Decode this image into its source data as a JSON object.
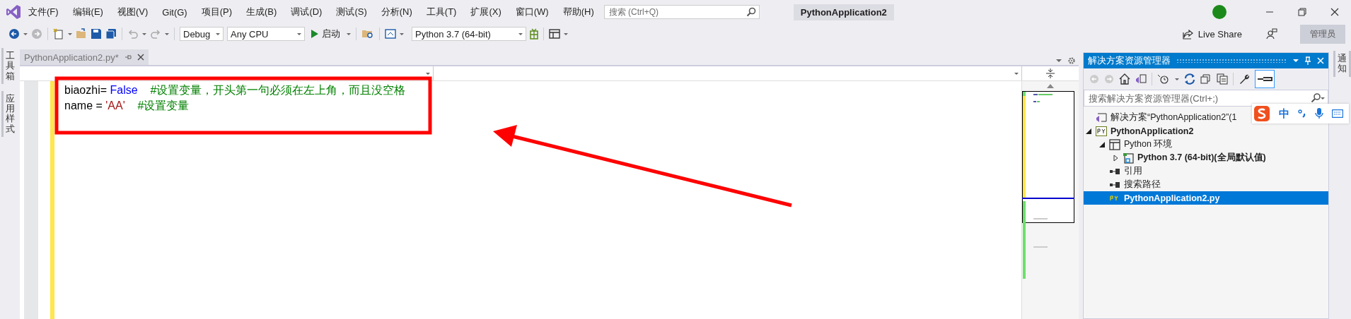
{
  "menu": [
    "文件(F)",
    "编辑(E)",
    "视图(V)",
    "Git(G)",
    "项目(P)",
    "生成(B)",
    "调试(D)",
    "测试(S)",
    "分析(N)",
    "工具(T)",
    "扩展(X)",
    "窗口(W)",
    "帮助(H)"
  ],
  "search": {
    "placeholder": "搜索 (Ctrl+Q)"
  },
  "solution_name": "PythonApplication2",
  "toolbar": {
    "configuration": "Debug",
    "platform": "Any CPU",
    "start": "启动",
    "environment": "Python 3.7 (64-bit)"
  },
  "live_share": "Live Share",
  "admin": "管理员",
  "left_strip": [
    "工具箱",
    "应用样式"
  ],
  "right_strip": [
    "通知"
  ],
  "editor": {
    "tabs": [
      {
        "label": "PythonApplication2.py*",
        "selected": true
      }
    ],
    "lines": [
      [
        {
          "kind": "plain",
          "text": "biaozhi= "
        },
        {
          "kind": "keyword",
          "text": "False"
        },
        {
          "kind": "comment",
          "text": "    #设置变量，开头第一句必须在左上角，而且没空格"
        }
      ],
      [
        {
          "kind": "plain",
          "text": "name = "
        },
        {
          "kind": "string",
          "text": "'AA'"
        },
        {
          "kind": "comment",
          "text": "    #设置变量"
        }
      ]
    ]
  },
  "explorer": {
    "title": "解决方案资源管理器",
    "search_placeholder": "搜索解决方案资源管理器(Ctrl+;)",
    "tree": [
      {
        "kind": "solution",
        "label": "解决方案“PythonApplication2”(1",
        "bold": false,
        "selected": false
      },
      {
        "kind": "project",
        "label": "PythonApplication2",
        "bold": true,
        "selected": false,
        "expanded": true,
        "children": [
          {
            "kind": "environments",
            "label": "Python 环境",
            "bold": false,
            "selected": false,
            "expanded": true,
            "children": [
              {
                "kind": "interpreter",
                "label": "Python 3.7 (64-bit)(全局默认值)",
                "bold": true,
                "selected": false,
                "expanded": false
              }
            ]
          },
          {
            "kind": "references",
            "label": "引用",
            "bold": false,
            "selected": false
          },
          {
            "kind": "references",
            "label": "搜索路径",
            "bold": false,
            "selected": false
          },
          {
            "kind": "pyfile",
            "label": "PythonApplication2.py",
            "bold": true,
            "selected": true
          }
        ]
      }
    ]
  },
  "ime_bar": {
    "label": "中"
  }
}
